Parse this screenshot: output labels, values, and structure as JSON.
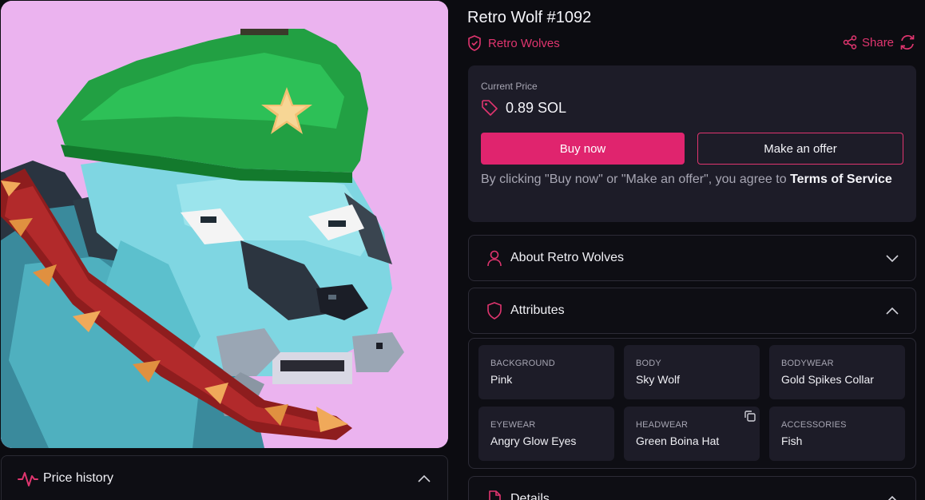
{
  "nft": {
    "title": "Retro Wolf #1092",
    "collection": "Retro Wolves",
    "image_alt": "Pixel-art wolf wearing a green beret with a gold star, spiked collar and a fish in its mouth"
  },
  "header_actions": {
    "share_label": "Share",
    "share_icon": "share-icon",
    "refresh_icon": "refresh-icon"
  },
  "pricing": {
    "label": "Current Price",
    "value": "0.89 SOL",
    "buy_label": "Buy now",
    "offer_label": "Make an offer",
    "terms_text": "By clicking \"Buy now\" or \"Make an offer\", you agree to ",
    "terms_link": "Terms of Service"
  },
  "sections": {
    "price_history": "Price history",
    "about": "About Retro Wolves",
    "attributes": "Attributes",
    "details": "Details"
  },
  "attributes": [
    {
      "type": "BACKGROUND",
      "value": "Pink"
    },
    {
      "type": "BODY",
      "value": "Sky Wolf"
    },
    {
      "type": "BODYWEAR",
      "value": "Gold Spikes Collar"
    },
    {
      "type": "EYEWEAR",
      "value": "Angry Glow Eyes"
    },
    {
      "type": "HEADWEAR",
      "value": "Green Boina Hat"
    },
    {
      "type": "ACCESSORIES",
      "value": "Fish"
    }
  ],
  "colors": {
    "accent": "#e0246e",
    "background": "#0c0c11",
    "card": "#1d1c28",
    "nft_background": "#ebb3ef"
  }
}
